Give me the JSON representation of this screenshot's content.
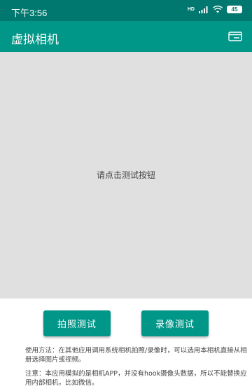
{
  "status_bar": {
    "time": "下午3:56",
    "network_label": "HD",
    "battery_level": "45",
    "icons": [
      "signal-icon",
      "wifi-icon",
      "battery-icon"
    ]
  },
  "app_bar": {
    "title": "虚拟相机",
    "right_icon": "card-icon"
  },
  "preview": {
    "message": "请点击测试按钮"
  },
  "buttons": {
    "photo_test": "拍照测试",
    "video_test": "录像测试"
  },
  "notes": {
    "usage": "使用方法：在其他应用调用系统相机拍照/录像时，可以选用本相机直接从相册选择图片或视频。",
    "warning": "注意：本应用模拟的是相机APP，并没有hook摄像头数据，所以不能替换应用内部相机，比如微信。"
  },
  "colors": {
    "status_bar": "#00786f",
    "primary": "#009688",
    "preview_bg": "#e0e0e0"
  }
}
